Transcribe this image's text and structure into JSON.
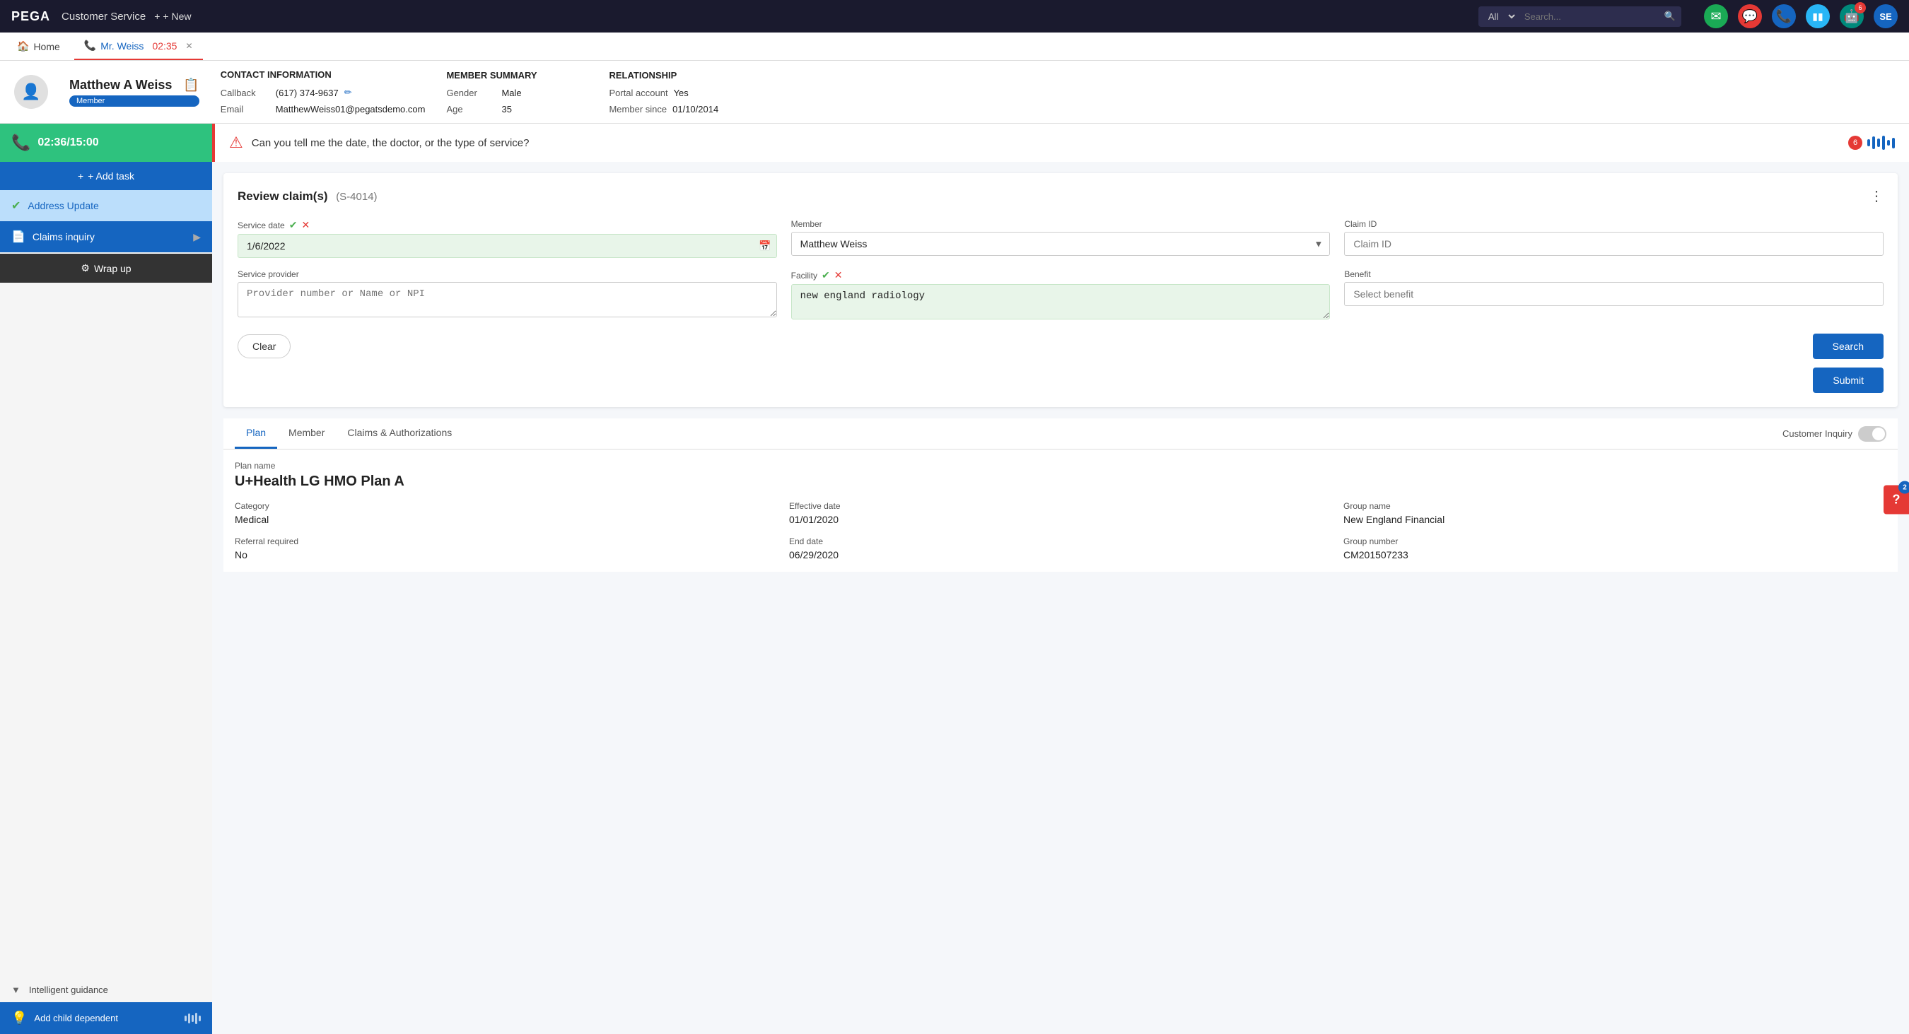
{
  "topNav": {
    "logo": "PEGA",
    "appName": "Customer Service",
    "newBtn": "+ New",
    "searchPlaceholder": "Search...",
    "searchAllOption": "All",
    "icons": {
      "email": "✉",
      "chat": "💬",
      "phone": "📞",
      "battery": "🔋",
      "bot": "🤖",
      "avatar": "SE"
    },
    "emailBadge": "",
    "waveBadge": "6"
  },
  "tabBar": {
    "homeLabel": "Home",
    "activeTabLabel": "Mr. Weiss",
    "activeTabTime": "02:35",
    "phoneIcon": "📞"
  },
  "memberHeader": {
    "name": "Matthew A Weiss",
    "badge": "Member",
    "contactTitle": "CONTACT INFORMATION",
    "callback": "(617) 374-9637",
    "email": "MatthewWeiss01@pegatsdemo.com",
    "callbackLabel": "Callback",
    "emailLabel": "Email",
    "summaryTitle": "MEMBER SUMMARY",
    "genderLabel": "Gender",
    "genderValue": "Male",
    "ageLabel": "Age",
    "ageValue": "35",
    "relationshipTitle": "RELATIONSHIP",
    "portalAccountLabel": "Portal account",
    "portalAccountValue": "Yes",
    "memberSinceLabel": "Member since",
    "memberSinceValue": "01/10/2014"
  },
  "sidebar": {
    "timerLabel": "02:36/15:00",
    "addTaskBtn": "+ Add task",
    "addressUpdateLabel": "Address Update",
    "claimsInquiryLabel": "Claims inquiry",
    "wrapUpLabel": "Wrap up",
    "intelligentGuidanceLabel": "Intelligent guidance",
    "addChildDependentLabel": "Add child dependent"
  },
  "chatBar": {
    "message": "Can you tell me the date, the doctor, or the type of service?",
    "waveBadge": "6"
  },
  "reviewCard": {
    "title": "Review claim(s)",
    "id": "(S-4014)",
    "serviceDateLabel": "Service date",
    "serviceDateValue": "1/6/2022",
    "memberLabel": "Member",
    "memberValue": "Matthew Weiss",
    "claimIdLabel": "Claim ID",
    "claimIdPlaceholder": "Claim ID",
    "serviceProviderLabel": "Service provider",
    "serviceProviderPlaceholder": "Provider number or Name or NPI",
    "facilityLabel": "Facility",
    "facilityValue": "new england radiology",
    "benefitLabel": "Benefit",
    "benefitPlaceholder": "Select benefit",
    "clearBtn": "Clear",
    "searchBtn": "Search",
    "submitBtn": "Submit"
  },
  "planSection": {
    "tabs": [
      "Plan",
      "Member",
      "Claims & Authorizations"
    ],
    "activeTab": "Plan",
    "customerInquiryLabel": "Customer Inquiry",
    "planNameLabel": "Plan name",
    "planName": "U+Health LG HMO Plan A",
    "categoryLabel": "Category",
    "categoryValue": "Medical",
    "effectiveDateLabel": "Effective date",
    "effectiveDateValue": "01/01/2020",
    "groupNameLabel": "Group name",
    "groupNameValue": "New England Financial",
    "referralRequiredLabel": "Referral required",
    "referralRequiredValue": "No",
    "endDateLabel": "End date",
    "endDateValue": "06/29/2020",
    "groupNumberLabel": "Group number",
    "groupNumberValue": "CM201507233"
  },
  "help": {
    "badge": "2",
    "label": "?"
  }
}
